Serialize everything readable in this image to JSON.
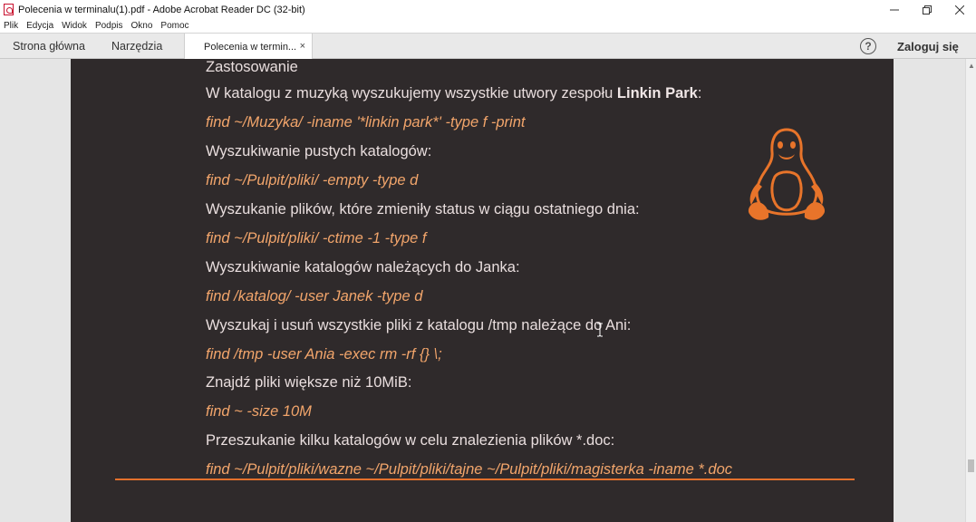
{
  "window": {
    "title": "Polecenia w terminalu(1).pdf - Adobe Acrobat Reader DC (32-bit)"
  },
  "menu": [
    "Plik",
    "Edycja",
    "Widok",
    "Podpis",
    "Okno",
    "Pomoc"
  ],
  "tabs": {
    "home": "Strona główna",
    "tools": "Narzędzia",
    "document": "Polecenia w termin...",
    "close_glyph": "×"
  },
  "toolbar": {
    "help_glyph": "?",
    "login": "Zaloguj się"
  },
  "page": {
    "lines": [
      {
        "text": "Zastosowanie",
        "type": "text"
      },
      {
        "text_before": "W katalogu z muzyką wyszukujemy wszystkie utwory zespołu ",
        "bold": "Linkin Park",
        "text_after": ":",
        "type": "text"
      },
      {
        "text": "find ~/Muzyka/ -iname '*linkin park*' -type f -print",
        "type": "cmd"
      },
      {
        "text": "Wyszukiwanie pustych katalogów:",
        "type": "text"
      },
      {
        "text": "find ~/Pulpit/pliki/ -empty -type d",
        "type": "cmd"
      },
      {
        "text": "Wyszukanie plików, które zmieniły status w ciągu ostatniego dnia:",
        "type": "text"
      },
      {
        "text": "find ~/Pulpit/pliki/ -ctime -1 -type f",
        "type": "cmd"
      },
      {
        "text": "Wyszukiwanie katalogów należących do Janka:",
        "type": "text"
      },
      {
        "text": "find /katalog/ -user Janek -type d",
        "type": "cmd"
      },
      {
        "text": "Wyszukaj i usuń wszystkie pliki z katalogu /tmp należące do Ani:",
        "type": "text"
      },
      {
        "text": "find /tmp -user Ania -exec rm -rf {} \\;",
        "type": "cmd"
      },
      {
        "text": "Znajdź pliki większe niż 10MiB:",
        "type": "text"
      },
      {
        "text": "find ~ -size 10M",
        "type": "cmd"
      },
      {
        "text": "Przeszukanie kilku katalogów w celu znalezienia plików *.doc:",
        "type": "text"
      },
      {
        "text": "find ~/Pulpit/pliki/wazne ~/Pulpit/pliki/tajne ~/Pulpit/pliki/magisterka -iname *.doc",
        "type": "cmd"
      }
    ]
  },
  "colors": {
    "page_background": "#2f2a2b",
    "command_text": "#f2a56b",
    "accent_rule": "#e3702c",
    "tux": "#e8742a"
  },
  "icons": {
    "app": "acrobat-icon",
    "minimize": "minimize-icon",
    "restore": "restore-icon",
    "close": "close-icon",
    "help": "help-icon",
    "decoration": "tux-penguin-icon"
  }
}
